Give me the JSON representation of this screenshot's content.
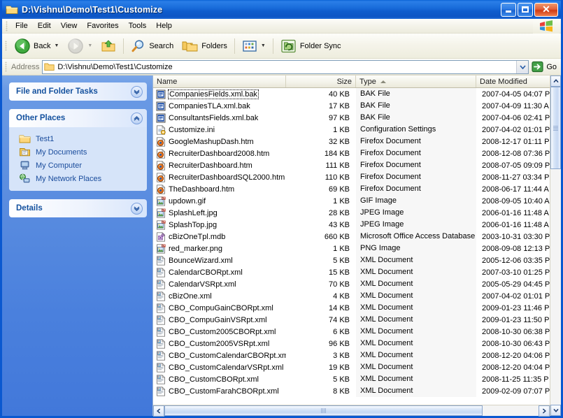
{
  "window": {
    "title": "D:\\Vishnu\\Demo\\Test1\\Customize",
    "folder_icon": "folder-icon",
    "minimize_label": "",
    "maximize_label": "",
    "close_label": "✕"
  },
  "menu": {
    "items": [
      {
        "label": "File"
      },
      {
        "label": "Edit"
      },
      {
        "label": "View"
      },
      {
        "label": "Favorites"
      },
      {
        "label": "Tools"
      },
      {
        "label": "Help"
      }
    ],
    "branding_icon": "windows-flag-icon"
  },
  "toolbar": {
    "back_label": "Back",
    "back_icon": "back-arrow-icon",
    "forward_icon": "forward-arrow-icon",
    "up_icon": "up-folder-icon",
    "search_label": "Search",
    "search_icon": "magnifier-icon",
    "folders_label": "Folders",
    "folders_icon": "folders-icon",
    "views_icon": "views-icon",
    "folder_sync_label": "Folder Sync",
    "folder_sync_icon": "folder-sync-icon"
  },
  "address": {
    "label": "Address",
    "value": "D:\\Vishnu\\Demo\\Test1\\Customize",
    "placeholder": "",
    "folder_icon": "folder-icon",
    "go_label": "Go",
    "go_icon": "go-arrow-icon",
    "dropdown_icon": "chevron-down-icon"
  },
  "sidebar": {
    "panels": [
      {
        "title": "File and Folder Tasks",
        "collapsed": true,
        "chevron": "chevron-down-icon",
        "items": []
      },
      {
        "title": "Other Places",
        "collapsed": false,
        "chevron": "chevron-up-icon",
        "items": [
          {
            "label": "Test1",
            "icon": "folder-icon"
          },
          {
            "label": "My Documents",
            "icon": "my-documents-icon"
          },
          {
            "label": "My Computer",
            "icon": "my-computer-icon"
          },
          {
            "label": "My Network Places",
            "icon": "network-places-icon"
          }
        ]
      },
      {
        "title": "Details",
        "collapsed": true,
        "chevron": "chevron-down-icon",
        "items": []
      }
    ]
  },
  "filelist": {
    "columns": [
      {
        "label": "Name",
        "sorted": false
      },
      {
        "label": "Size",
        "sorted": false
      },
      {
        "label": "Type",
        "sorted": true,
        "direction": "asc"
      },
      {
        "label": "Date Modified",
        "sorted": false
      }
    ],
    "rows": [
      {
        "name": "CompaniesFields.xml.bak",
        "size": "40 KB",
        "type": "BAK File",
        "date": "2007-04-05 04:07 P",
        "icon": "bak-file-icon",
        "focused": true
      },
      {
        "name": "CompaniesTLA.xml.bak",
        "size": "17 KB",
        "type": "BAK File",
        "date": "2007-04-09 11:30 A",
        "icon": "bak-file-icon",
        "focused": false
      },
      {
        "name": "ConsultantsFields.xml.bak",
        "size": "97 KB",
        "type": "BAK File",
        "date": "2007-04-06 02:41 P",
        "icon": "bak-file-icon",
        "focused": false
      },
      {
        "name": "Customize.ini",
        "size": "1 KB",
        "type": "Configuration Settings",
        "date": "2007-04-02 01:01 P",
        "icon": "ini-file-icon",
        "focused": false
      },
      {
        "name": "GoogleMashupDash.htm",
        "size": "32 KB",
        "type": "Firefox Document",
        "date": "2008-12-17 01:11 P",
        "icon": "firefox-doc-icon",
        "focused": false
      },
      {
        "name": "RecruiterDashboard2008.htm",
        "size": "184 KB",
        "type": "Firefox Document",
        "date": "2008-12-08 07:36 P",
        "icon": "firefox-doc-icon",
        "focused": false
      },
      {
        "name": "RecruiterDashboard.htm",
        "size": "111 KB",
        "type": "Firefox Document",
        "date": "2008-07-05 09:09 P",
        "icon": "firefox-doc-icon",
        "focused": false
      },
      {
        "name": "RecruiterDashboardSQL2000.htm",
        "size": "110 KB",
        "type": "Firefox Document",
        "date": "2008-11-27 03:34 P",
        "icon": "firefox-doc-icon",
        "focused": false
      },
      {
        "name": "TheDashboard.htm",
        "size": "69 KB",
        "type": "Firefox Document",
        "date": "2008-06-17 11:44 A",
        "icon": "firefox-doc-icon",
        "focused": false
      },
      {
        "name": "updown.gif",
        "size": "1 KB",
        "type": "GIF Image",
        "date": "2008-09-05 10:40 A",
        "icon": "image-file-icon",
        "focused": false
      },
      {
        "name": "SplashLeft.jpg",
        "size": "28 KB",
        "type": "JPEG Image",
        "date": "2006-01-16 11:48 A",
        "icon": "image-file-icon",
        "focused": false
      },
      {
        "name": "SplashTop.jpg",
        "size": "43 KB",
        "type": "JPEG Image",
        "date": "2006-01-16 11:48 A",
        "icon": "image-file-icon",
        "focused": false
      },
      {
        "name": "cBizOneTpl.mdb",
        "size": "660 KB",
        "type": "Microsoft Office Access Database",
        "date": "2003-10-31 03:30 P",
        "icon": "access-db-icon",
        "focused": false
      },
      {
        "name": "red_marker.png",
        "size": "1 KB",
        "type": "PNG Image",
        "date": "2008-09-08 12:13 P",
        "icon": "image-file-icon",
        "focused": false
      },
      {
        "name": "BounceWizard.xml",
        "size": "5 KB",
        "type": "XML Document",
        "date": "2005-12-06 03:35 P",
        "icon": "xml-doc-icon",
        "focused": false
      },
      {
        "name": "CalendarCBORpt.xml",
        "size": "15 KB",
        "type": "XML Document",
        "date": "2007-03-10 01:25 P",
        "icon": "xml-doc-icon",
        "focused": false
      },
      {
        "name": "CalendarVSRpt.xml",
        "size": "70 KB",
        "type": "XML Document",
        "date": "2005-05-29 04:45 P",
        "icon": "xml-doc-icon",
        "focused": false
      },
      {
        "name": "cBizOne.xml",
        "size": "4 KB",
        "type": "XML Document",
        "date": "2007-04-02 01:01 P",
        "icon": "xml-doc-icon",
        "focused": false
      },
      {
        "name": "CBO_CompuGainCBORpt.xml",
        "size": "14 KB",
        "type": "XML Document",
        "date": "2009-01-23 11:46 P",
        "icon": "xml-doc-icon",
        "focused": false
      },
      {
        "name": "CBO_CompuGainVSRpt.xml",
        "size": "74 KB",
        "type": "XML Document",
        "date": "2009-01-23 11:50 P",
        "icon": "xml-doc-icon",
        "focused": false
      },
      {
        "name": "CBO_Custom2005CBORpt.xml",
        "size": "6 KB",
        "type": "XML Document",
        "date": "2008-10-30 06:38 P",
        "icon": "xml-doc-icon",
        "focused": false
      },
      {
        "name": "CBO_Custom2005VSRpt.xml",
        "size": "96 KB",
        "type": "XML Document",
        "date": "2008-10-30 06:43 P",
        "icon": "xml-doc-icon",
        "focused": false
      },
      {
        "name": "CBO_CustomCalendarCBORpt.xml",
        "size": "3 KB",
        "type": "XML Document",
        "date": "2008-12-20 04:06 P",
        "icon": "xml-doc-icon",
        "focused": false
      },
      {
        "name": "CBO_CustomCalendarVSRpt.xml",
        "size": "19 KB",
        "type": "XML Document",
        "date": "2008-12-20 04:04 P",
        "icon": "xml-doc-icon",
        "focused": false
      },
      {
        "name": "CBO_CustomCBORpt.xml",
        "size": "5 KB",
        "type": "XML Document",
        "date": "2008-11-25 11:35 P",
        "icon": "xml-doc-icon",
        "focused": false
      },
      {
        "name": "CBO_CustomFarahCBORpt.xml",
        "size": "8 KB",
        "type": "XML Document",
        "date": "2009-02-09 07:07 P",
        "icon": "xml-doc-icon",
        "focused": false
      }
    ],
    "scroll": {
      "vertical_up_icon": "chevron-up-icon",
      "vertical_down_icon": "chevron-down-icon",
      "horizontal_left_icon": "chevron-left-icon",
      "horizontal_right_icon": "chevron-right-icon"
    }
  },
  "colors": {
    "titlebar_blue": "#0f5ccd",
    "sidebar_blue": "#5b8edc",
    "panel_body": "#d6e4f9",
    "link_blue": "#1a4c9c",
    "heading_blue": "#14519e",
    "sort_column_bg": "#f7f7f7"
  }
}
